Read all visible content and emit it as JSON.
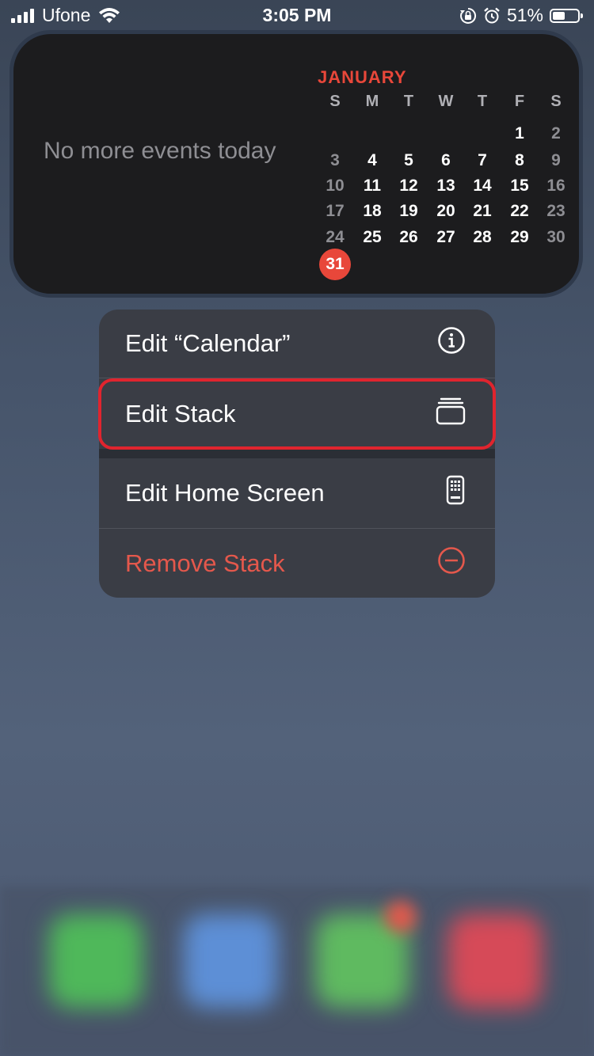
{
  "status_bar": {
    "carrier": "Ufone",
    "time": "3:05 PM",
    "battery_percent": "51%",
    "battery_level": 0.51
  },
  "widget": {
    "no_events_text": "No more events today",
    "month": "JANUARY",
    "weekdays": [
      "S",
      "M",
      "T",
      "W",
      "T",
      "F",
      "S"
    ],
    "days": [
      [
        "",
        "",
        "",
        "",
        "",
        "1",
        "2"
      ],
      [
        "3",
        "4",
        "5",
        "6",
        "7",
        "8",
        "9"
      ],
      [
        "10",
        "11",
        "12",
        "13",
        "14",
        "15",
        "16"
      ],
      [
        "17",
        "18",
        "19",
        "20",
        "21",
        "22",
        "23"
      ],
      [
        "24",
        "25",
        "26",
        "27",
        "28",
        "29",
        "30"
      ],
      [
        "31",
        "",
        "",
        "",
        "",
        "",
        ""
      ]
    ],
    "today": "31"
  },
  "menu": {
    "items": [
      {
        "label": "Edit “Calendar”",
        "icon": "info-icon"
      },
      {
        "label": "Edit Stack",
        "icon": "stack-icon"
      },
      {
        "label": "Edit Home Screen",
        "icon": "phone-home-icon"
      },
      {
        "label": "Remove Stack",
        "icon": "minus-circle-icon"
      }
    ]
  },
  "colors": {
    "accent_red": "#e4584c",
    "highlight_border": "#e0242e"
  }
}
